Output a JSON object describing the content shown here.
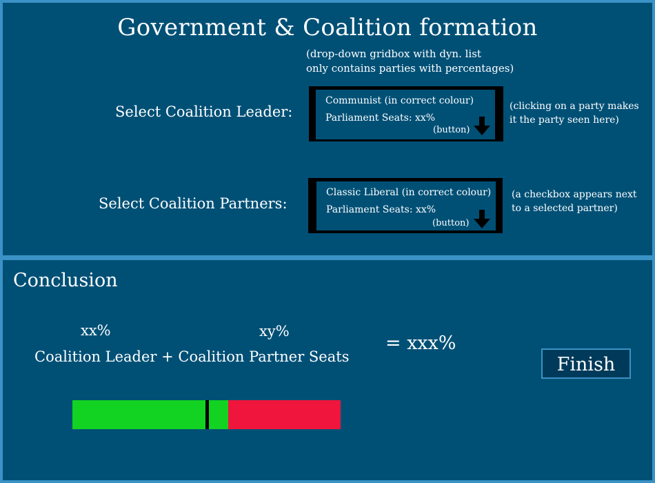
{
  "header": {
    "title": "Government & Coalition formation",
    "note": "(drop-down gridbox with dyn. list\nonly contains parties with percentages)"
  },
  "leader": {
    "label": "Select Coalition Leader:",
    "party": "Communist (in correct colour)",
    "seats": "Parliament Seats: xx%",
    "button_label": "(button)",
    "button_icon": "arrow-down-icon",
    "note": "(clicking on a party makes\nit the party seen here)"
  },
  "partners": {
    "label": "Select Coalition Partners:",
    "party": "Classic Liberal (in correct colour)",
    "seats": "Parliament Seats: xx%",
    "button_label": "(button)",
    "button_icon": "arrow-down-icon",
    "note": "(a checkbox appears next\nto a selected partner)"
  },
  "conclusion": {
    "title": "Conclusion",
    "leader_pct": "xx%",
    "partner_pct": "xy%",
    "expression": "Coalition Leader + Coalition Partner Seats",
    "total": "= xxx%",
    "finish_label": "Finish",
    "seat_bar": {
      "coalition_fraction": 0.58,
      "majority_fraction": 0.505,
      "coalition_color": "#12d222",
      "other_color": "#f0153c",
      "majority_marker_color": "#000000"
    }
  },
  "colors": {
    "background": "#005076",
    "border": "#3a92c6"
  }
}
